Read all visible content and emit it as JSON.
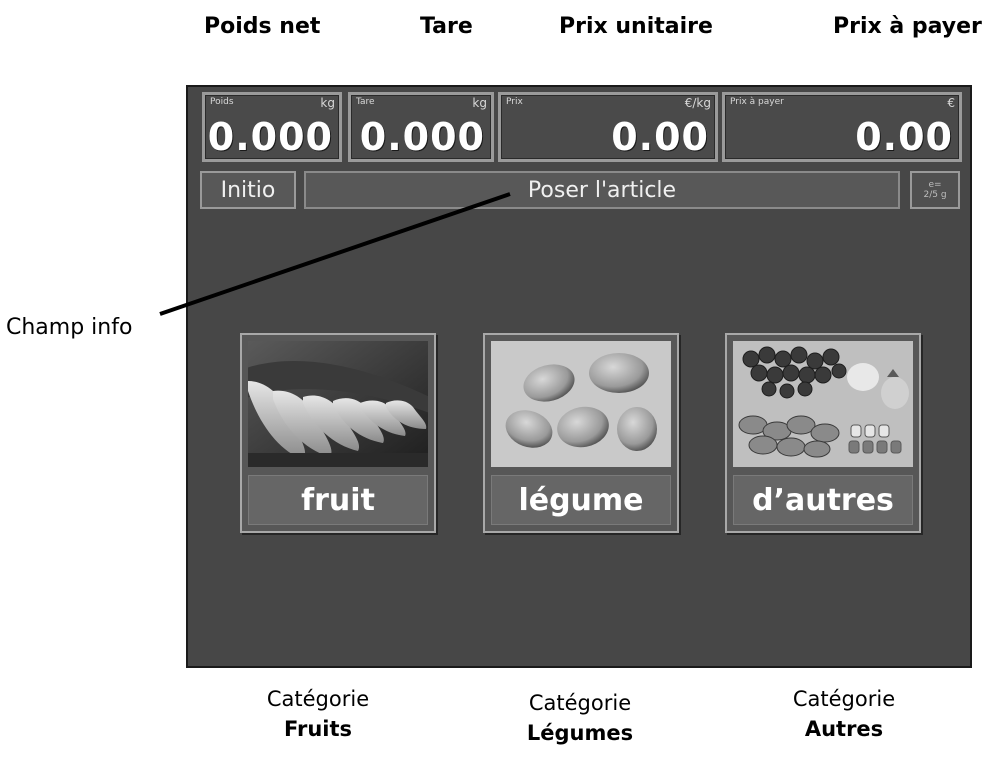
{
  "annotations": {
    "poids_net": "Poids net",
    "tare": "Tare",
    "prix_unitaire": "Prix unitaire",
    "prix_a_payer": "Prix à payer",
    "champ_info": "Champ info"
  },
  "display": {
    "weight": {
      "caption": "Poids",
      "unit": "kg",
      "value": "0.000"
    },
    "tare": {
      "caption": "Tare",
      "unit": "kg",
      "value": "0.000"
    },
    "price": {
      "caption": "Prix",
      "unit": "€/kg",
      "value": "0.00"
    },
    "total": {
      "caption": "Prix à payer",
      "unit": "€",
      "value": "0.00"
    }
  },
  "toolbar": {
    "initio_label": "Initio",
    "info_text": "Poser l'article",
    "e_line1": "e=",
    "e_line2": "2/5 g"
  },
  "categories": [
    {
      "label": "fruit",
      "image": "bananas-photo",
      "caption_top": "Catégorie",
      "caption_bottom": "Fruits"
    },
    {
      "label": "légume",
      "image": "potatoes-photo",
      "caption_top": "Catégorie",
      "caption_bottom": "Légumes"
    },
    {
      "label": "d’autres",
      "image": "mixed-produce-photo",
      "caption_top": "Catégorie",
      "caption_bottom": "Autres"
    }
  ],
  "colors": {
    "screen_bg": "#474747",
    "field_border": "#9a9a9a",
    "text": "#ffffff"
  }
}
